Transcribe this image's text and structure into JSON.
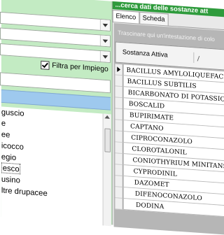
{
  "left": {
    "filter_checkbox_label": "Filtra per Impiego",
    "filter_checked": true,
    "list_items": [
      {
        "label": "guscio",
        "selected": false
      },
      {
        "label": "e",
        "selected": false
      },
      {
        "label": "ee",
        "selected": false
      },
      {
        "label": "icocco",
        "selected": false
      },
      {
        "label": "egio",
        "selected": false
      },
      {
        "label": "esco",
        "selected": true
      },
      {
        "label": "usino",
        "selected": false
      },
      {
        "label": "ltre drupacee",
        "selected": false
      }
    ]
  },
  "right": {
    "banner_title": "...cerca dati delle sostanze att",
    "tabs": [
      {
        "label": "Elenco",
        "active": true
      },
      {
        "label": "Scheda",
        "active": false
      }
    ],
    "group_hint": "Trascinare qui un'intestazione di colo",
    "column_header": "Sostanza Attiva",
    "rows": [
      "BACILLUS AMYLOLIQUEFACIENS",
      "BACILLUS SUBTILIS",
      "BICARBONATO DI POTASSIO",
      "BOSCALID",
      "BUPIRIMATE",
      "CAPTANO",
      "CIPROCONAZOLO",
      "CLOROTALONIL",
      "CONIOTHYRIUM MINITANS",
      "CYPRODINIL",
      "DAZOMET",
      "DIFENOCONAZOLO",
      "DODINA"
    ],
    "current_row_index": 0
  }
}
